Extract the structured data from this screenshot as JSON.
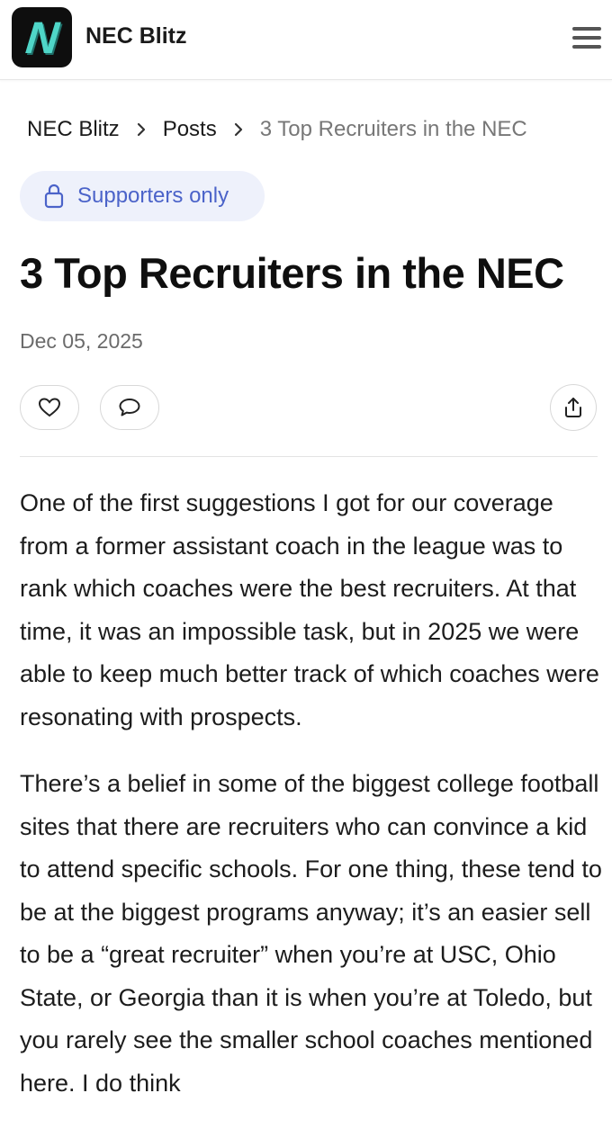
{
  "header": {
    "logo_letter": "N",
    "brand": "NEC Blitz",
    "menu_icon": "hamburger-menu-icon"
  },
  "breadcrumb": {
    "items": [
      "NEC Blitz",
      "Posts"
    ],
    "current": "3 Top Recruiters in the NEC"
  },
  "badge": {
    "label": "Supporters only",
    "icon": "lock-icon"
  },
  "article": {
    "title": "3 Top Recruiters in the NEC",
    "date": "Dec 05, 2025",
    "paragraphs": [
      "One of the first suggestions I got for our coverage from a former assistant coach in the league was to rank which coaches were the best recruiters. At that time, it was an impossible task, but in 2025 we were able to keep much better track of which coaches were resonating with prospects.",
      "There’s a belief in some of the biggest college football sites that there are recruiters who can convince a kid to attend specific schools. For one thing, these tend to be at the biggest programs anyway; it’s an easier sell to be a “great recruiter” when you’re at USC, Ohio State, or Georgia than it is when you’re at Toledo, but you rarely see the smaller school coaches mentioned here. I do think"
    ]
  },
  "actions": {
    "like_icon": "heart-icon",
    "comment_icon": "comment-icon",
    "share_icon": "share-icon"
  },
  "colors": {
    "accent": "#4b63c9",
    "badge_bg": "#eef1fb",
    "logo_bg": "#0e0e0e",
    "logo_fg": "#4fd6c8"
  }
}
